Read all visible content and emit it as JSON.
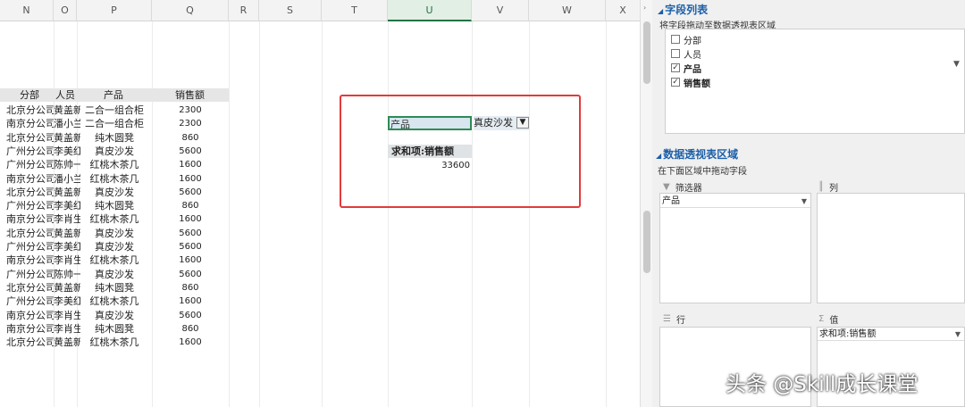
{
  "columns": [
    "N",
    "O",
    "P",
    "Q",
    "R",
    "S",
    "T",
    "U",
    "V",
    "W",
    "X"
  ],
  "table": {
    "headers": [
      "分部",
      "人员",
      "产品",
      "销售额"
    ],
    "rows": [
      [
        "北京分公司",
        "黄盖新",
        "二合一组合柜",
        "2300"
      ],
      [
        "南京分公司",
        "潘小兰",
        "二合一组合柜",
        "2300"
      ],
      [
        "北京分公司",
        "黄盖新",
        "纯木圆凳",
        "860"
      ],
      [
        "广州分公司",
        "李美红",
        "真皮沙发",
        "5600"
      ],
      [
        "广州分公司",
        "陈帅一",
        "红桃木茶几",
        "1600"
      ],
      [
        "南京分公司",
        "潘小兰",
        "红桃木茶几",
        "1600"
      ],
      [
        "北京分公司",
        "黄盖新",
        "真皮沙发",
        "5600"
      ],
      [
        "广州分公司",
        "李美红",
        "纯木圆凳",
        "860"
      ],
      [
        "南京分公司",
        "李肖生",
        "红桃木茶几",
        "1600"
      ],
      [
        "北京分公司",
        "黄盖新",
        "真皮沙发",
        "5600"
      ],
      [
        "广州分公司",
        "李美红",
        "真皮沙发",
        "5600"
      ],
      [
        "南京分公司",
        "李肖生",
        "红桃木茶几",
        "1600"
      ],
      [
        "广州分公司",
        "陈帅一",
        "真皮沙发",
        "5600"
      ],
      [
        "北京分公司",
        "黄盖新",
        "纯木圆凳",
        "860"
      ],
      [
        "广州分公司",
        "李美红",
        "红桃木茶几",
        "1600"
      ],
      [
        "南京分公司",
        "李肖生",
        "真皮沙发",
        "5600"
      ],
      [
        "南京分公司",
        "李肖生",
        "纯木圆凳",
        "860"
      ],
      [
        "北京分公司",
        "黄盖新",
        "红桃木茶几",
        "1600"
      ]
    ]
  },
  "pivot": {
    "filter_field": "产品",
    "filter_value": "真皮沙发",
    "value_header": "求和项:销售额",
    "total": "33600"
  },
  "panel": {
    "field_list_title": "字段列表",
    "field_list_hint": "将字段拖动至数据透视表区域",
    "fields": [
      {
        "label": "分部",
        "checked": false
      },
      {
        "label": "人员",
        "checked": false
      },
      {
        "label": "产品",
        "checked": true
      },
      {
        "label": "销售额",
        "checked": true
      }
    ],
    "areas_title": "数据透视表区域",
    "areas_hint": "在下面区域中拖动字段",
    "filter_label": "筛选器",
    "columns_label": "列",
    "rows_label": "行",
    "values_label": "值",
    "filter_item": "产品",
    "values_item": "求和项:销售额"
  },
  "watermark": "头条 @Skill成长课堂",
  "colors": {
    "accent_green": "#217346",
    "highlight_red": "#e33a3a",
    "panel_title_blue": "#1d5fa8"
  }
}
